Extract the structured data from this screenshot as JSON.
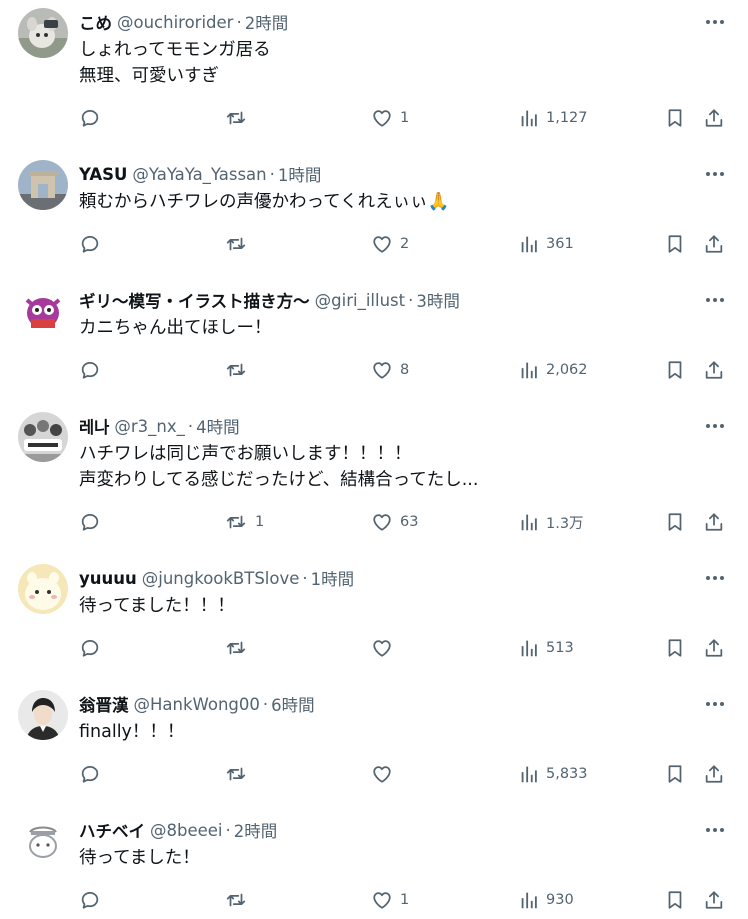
{
  "replies": [
    {
      "name": "こめ",
      "handle": "@ouchirorider",
      "time": "2時間",
      "text": [
        "しょれってモモンガ居る",
        "無理、可愛いすぎ"
      ],
      "replies": "",
      "reposts": "",
      "likes": "1",
      "views": "1,127",
      "avatar_icon": "plush-toy-avatar"
    },
    {
      "name": "YASU",
      "handle": "@YaYaYa_Yassan",
      "time": "1時間",
      "text": [
        "頼むからハチワレの声優かわってくれえぃぃ🙏"
      ],
      "replies": "",
      "reposts": "",
      "likes": "2",
      "views": "361",
      "avatar_icon": "arch-photo-avatar"
    },
    {
      "name": "ギリ～模写・イラスト描き方～",
      "handle": "@giri_illust",
      "time": "3時間",
      "text": [
        "カニちゃん出てほしー！"
      ],
      "replies": "",
      "reposts": "",
      "likes": "8",
      "views": "2,062",
      "avatar_icon": "owl-mascot-avatar"
    },
    {
      "name": "레나",
      "handle": "@r3_nx_",
      "time": "4時間",
      "text": [
        "ハチワレは同じ声でお願いします！！！！",
        "声変わりしてる感じだったけど、結構合ってたし..."
      ],
      "replies": "",
      "reposts": "1",
      "likes": "63",
      "views": "1.3万",
      "avatar_icon": "group-photo-avatar"
    },
    {
      "name": "yuuuu",
      "handle": "@jungkookBTSlove",
      "time": "1時間",
      "text": [
        "待ってました！！！"
      ],
      "replies": "",
      "reposts": "",
      "likes": "",
      "views": "513",
      "avatar_icon": "character-face-avatar"
    },
    {
      "name": "翁晋漢",
      "handle": "@HankWong00",
      "time": "6時間",
      "text": [
        "finally！！！"
      ],
      "replies": "",
      "reposts": "",
      "likes": "",
      "views": "5,833",
      "avatar_icon": "portrait-drawing-avatar"
    },
    {
      "name": "ハチベイ",
      "handle": "@8beeei",
      "time": "2時間",
      "text": [
        "待ってました！"
      ],
      "replies": "",
      "reposts": "",
      "likes": "1",
      "views": "930",
      "avatar_icon": "sketch-character-avatar"
    }
  ],
  "separator": "·",
  "colors": {
    "text_primary": "#0f1419",
    "text_secondary": "#536471",
    "background": "#ffffff"
  },
  "icons": [
    "reply-icon",
    "repost-icon",
    "like-icon",
    "views-icon",
    "bookmark-icon",
    "share-icon",
    "more-icon"
  ]
}
